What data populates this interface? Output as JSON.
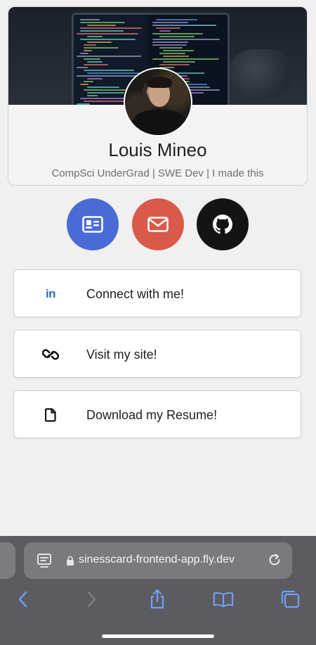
{
  "profile": {
    "name": "Louis Mineo",
    "tagline": "CompSci UnderGrad | SWE Dev | I made this"
  },
  "quick_actions": [
    {
      "name": "contact-card",
      "icon": "id-card-icon",
      "color": "#4a6bd6"
    },
    {
      "name": "email",
      "icon": "envelope-icon",
      "color": "#d95a4a"
    },
    {
      "name": "github",
      "icon": "github-icon",
      "color": "#141414"
    }
  ],
  "links": [
    {
      "label": "Connect with me!",
      "icon": "linkedin-icon",
      "icon_text": "in"
    },
    {
      "label": "Visit my site!",
      "icon": "link-icon"
    },
    {
      "label": "Download my Resume!",
      "icon": "document-icon"
    }
  ],
  "browser": {
    "url": "sinesscard-frontend-app.fly.dev",
    "toolbar": [
      "back-icon",
      "forward-icon",
      "share-icon",
      "bookmarks-icon",
      "tabs-icon"
    ],
    "accent": "#6fa0ff"
  }
}
